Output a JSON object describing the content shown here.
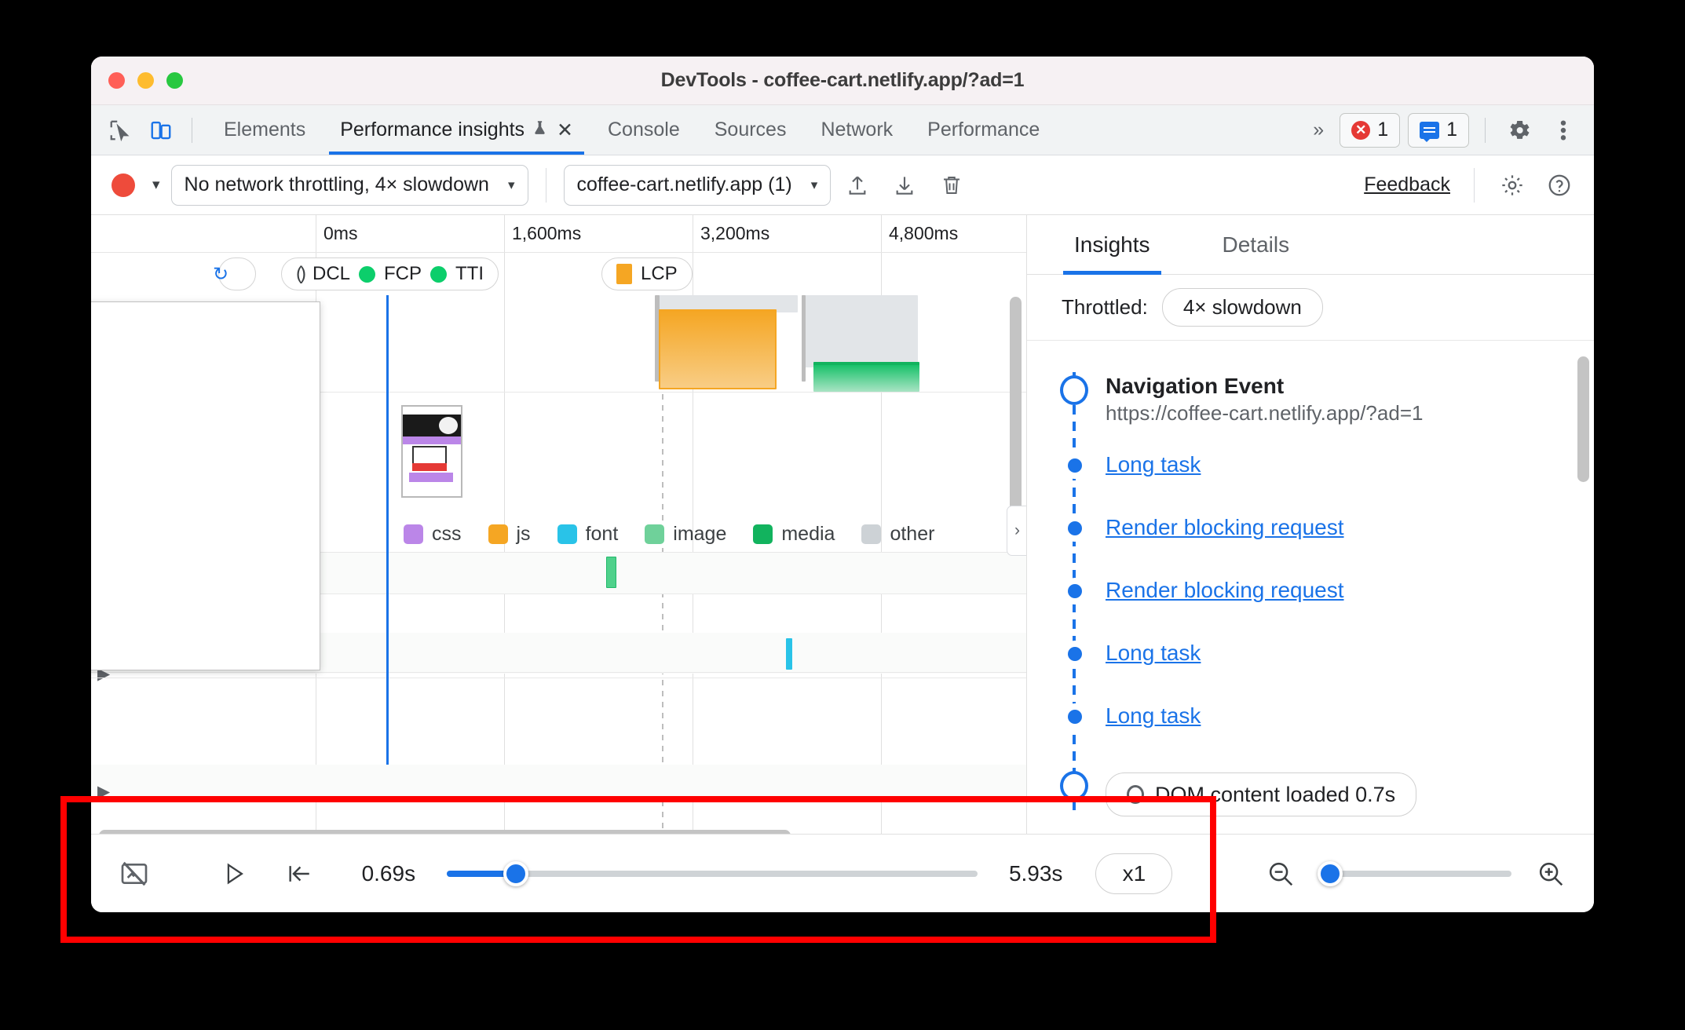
{
  "window": {
    "title": "DevTools - coffee-cart.netlify.app/?ad=1"
  },
  "tabbar": {
    "inspect_icon": "inspect-cursor-icon",
    "device_icon": "device-toolbar-icon",
    "tabs": [
      {
        "label": "Elements",
        "active": false
      },
      {
        "label": "Performance insights",
        "active": true,
        "flask": "⚗",
        "close": "✕"
      },
      {
        "label": "Console",
        "active": false
      },
      {
        "label": "Sources",
        "active": false
      },
      {
        "label": "Network",
        "active": false
      },
      {
        "label": "Performance",
        "active": false
      }
    ],
    "overflow": "»",
    "error_count": "1",
    "message_count": "1",
    "settings_icon": "gear-icon",
    "more_icon": "three-dot-menu-icon"
  },
  "toolbar": {
    "record_icon": "record-button-icon",
    "record_caret": "▾",
    "throttling": "No network throttling, 4× slowdown",
    "throttling_arrow": "▾",
    "page_select": "coffee-cart.netlify.app (1)",
    "page_select_arrow": "▾",
    "upload_icon": "upload-icon",
    "download_icon": "download-icon",
    "trash_icon": "trash-icon",
    "feedback": "Feedback",
    "settings_icon": "gear-icon",
    "help_icon": "help-icon"
  },
  "timeline": {
    "ticks": [
      "0ms",
      "1,600ms",
      "3,200ms",
      "4,800ms"
    ],
    "markers": [
      {
        "label": "DCL",
        "type": "glyph",
        "color": "#3c4043"
      },
      {
        "label": "FCP",
        "type": "dot",
        "color": "#0cce6b"
      },
      {
        "label": "TTI",
        "type": "dot",
        "color": "#0cce6b"
      }
    ],
    "lcp": {
      "label": "LCP",
      "color": "#f5a623"
    },
    "legend": [
      {
        "label": "css",
        "color": "#bb86e8"
      },
      {
        "label": "js",
        "color": "#f5a623"
      },
      {
        "label": "font",
        "color": "#29c3e8"
      },
      {
        "label": "image",
        "color": "#6fd19a"
      },
      {
        "label": "media",
        "color": "#12b35e"
      },
      {
        "label": "other",
        "color": "#cdd2d6"
      }
    ],
    "expand_arrow": "▶",
    "side_handle": "›"
  },
  "rightpanel": {
    "tabs": [
      {
        "label": "Insights",
        "active": true
      },
      {
        "label": "Details",
        "active": false
      }
    ],
    "throttled_label": "Throttled:",
    "throttled_value": "4× slowdown",
    "navigation": {
      "title": "Navigation Event",
      "url": "https://coffee-cart.netlify.app/?ad=1"
    },
    "items": [
      {
        "label": "Long task"
      },
      {
        "label": "Render blocking request"
      },
      {
        "label": "Render blocking request"
      },
      {
        "label": "Long task"
      },
      {
        "label": "Long task"
      }
    ],
    "dom_pill": "DOM content loaded 0.7s"
  },
  "bottombar": {
    "screenshots_icon": "hide-screenshots-icon",
    "play_icon": "▷",
    "reset_icon": "|←",
    "time_start": "0.69s",
    "time_end": "5.93s",
    "speed": "x1",
    "zoom_out_icon": "zoom-out-icon",
    "zoom_in_icon": "zoom-in-icon"
  },
  "annotation": {
    "highlight_color": "#ff0000"
  }
}
